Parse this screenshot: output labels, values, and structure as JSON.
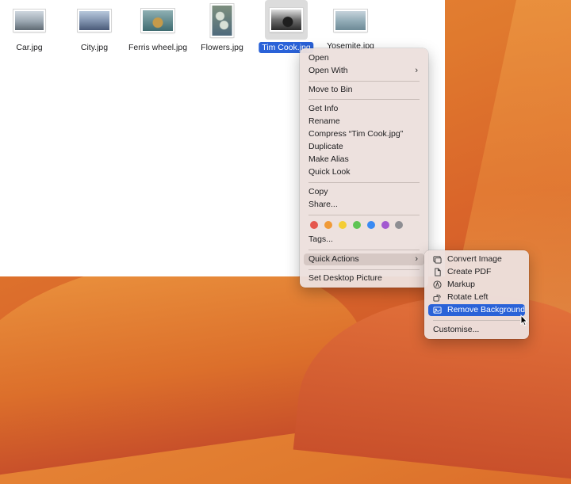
{
  "finder": {
    "files": [
      {
        "name": "Car.jpg",
        "thumb_colors": [
          "#cfd7df",
          "#5f6a73"
        ]
      },
      {
        "name": "City.jpg",
        "thumb_colors": [
          "#b8c8dc",
          "#4a5a78"
        ]
      },
      {
        "name": "Ferris wheel.jpg",
        "thumb_colors": [
          "#8fb0b3",
          "#3f6c71"
        ]
      },
      {
        "name": "Flowers.jpg",
        "thumb_colors": [
          "#c3c9c1",
          "#4e6a7c"
        ]
      },
      {
        "name": "Tim Cook.jpg",
        "thumb_colors": [
          "#e0e0e0",
          "#2b2b2b"
        ],
        "selected": true
      },
      {
        "name": "Yosemite.jpg",
        "thumb_colors": [
          "#c6d3db",
          "#6d8a96"
        ]
      }
    ]
  },
  "context_menu": {
    "open": "Open",
    "open_with": "Open With",
    "move_to_bin": "Move to Bin",
    "get_info": "Get Info",
    "rename": "Rename",
    "compress": "Compress “Tim Cook.jpg”",
    "duplicate": "Duplicate",
    "make_alias": "Make Alias",
    "quick_look": "Quick Look",
    "copy": "Copy",
    "share": "Share...",
    "tag_colors": [
      "#e5574d",
      "#f09a37",
      "#f4cd35",
      "#5fc454",
      "#3a8af3",
      "#a35ad0",
      "#8e8e93"
    ],
    "tags": "Tags...",
    "quick_actions": "Quick Actions",
    "set_desktop_picture": "Set Desktop Picture",
    "submenu_arrow": "›"
  },
  "quick_actions_menu": {
    "convert_image": "Convert Image",
    "create_pdf": "Create PDF",
    "markup": "Markup",
    "rotate_left": "Rotate Left",
    "remove_background": "Remove Background",
    "customise": "Customise..."
  },
  "colors": {
    "selection": "#2a62d8",
    "menu_bg": "#ece0dd",
    "wallpaper": "#e07a2e"
  }
}
